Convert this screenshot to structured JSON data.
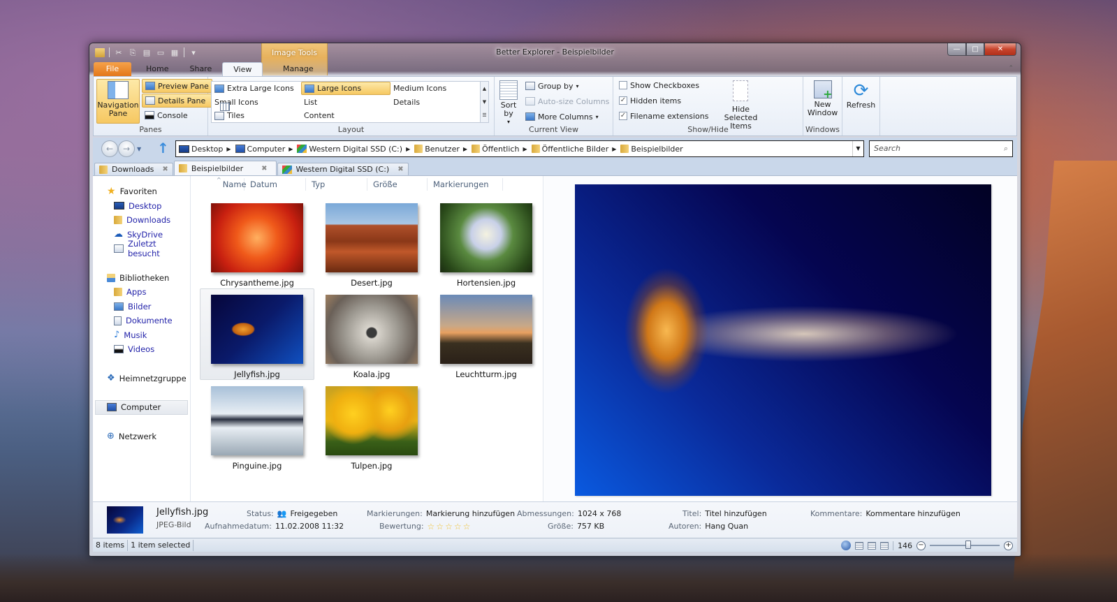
{
  "window": {
    "title": "Better Explorer - Beispielbilder",
    "controls": {
      "minimize": "—",
      "maximize": "□",
      "close": "✕"
    }
  },
  "ribbon": {
    "context_group": "Image Tools",
    "tabs": [
      "File",
      "Home",
      "Share",
      "View",
      "Manage"
    ],
    "active_tab": "View",
    "panes": {
      "label": "Panes",
      "navigation_pane": "Navigation Pane",
      "preview_pane": "Preview Pane",
      "details_pane": "Details Pane",
      "console": "Console"
    },
    "layout": {
      "label": "Layout",
      "items": [
        "Extra Large Icons",
        "Large Icons",
        "Medium Icons",
        "Small Icons",
        "List",
        "Details",
        "Tiles",
        "Content"
      ],
      "selected": "Large Icons"
    },
    "current_view": {
      "label": "Current View",
      "sort_by": "Sort by",
      "group_by": "Group by",
      "auto_size": "Auto-size Columns",
      "more_columns": "More Columns"
    },
    "show_hide": {
      "label": "Show/Hide",
      "show_checkboxes": {
        "label": "Show Checkboxes",
        "checked": false
      },
      "hidden_items": {
        "label": "Hidden items",
        "checked": true
      },
      "filename_extensions": {
        "label": "Filename extensions",
        "checked": true
      },
      "hide_selected": "Hide Selected Items"
    },
    "windows": {
      "label": "Windows",
      "new_window": "New Window"
    },
    "refresh": "Refresh"
  },
  "navigation": {
    "breadcrumb": [
      "Desktop",
      "Computer",
      "Western Digital SSD (C:)",
      "Benutzer",
      "Öffentlich",
      "Öffentliche Bilder",
      "Beispielbilder"
    ],
    "search_placeholder": "Search"
  },
  "folder_tabs": [
    {
      "label": "Downloads",
      "active": false
    },
    {
      "label": "Beispielbilder",
      "active": true
    },
    {
      "label": "Western Digital SSD (C:)",
      "active": false
    }
  ],
  "sidebar": {
    "favorites": {
      "label": "Favoriten",
      "items": [
        "Desktop",
        "Downloads",
        "SkyDrive",
        "Zuletzt besucht"
      ]
    },
    "libraries": {
      "label": "Bibliotheken",
      "items": [
        "Apps",
        "Bilder",
        "Dokumente",
        "Musik",
        "Videos"
      ]
    },
    "homegroup": "Heimnetzgruppe",
    "computer": "Computer",
    "network": "Netzwerk"
  },
  "file_list": {
    "columns": [
      "Name",
      "Datum",
      "Typ",
      "Größe",
      "Markierungen"
    ],
    "files": [
      {
        "name": "Chrysantheme.jpg",
        "selected": false
      },
      {
        "name": "Desert.jpg",
        "selected": false
      },
      {
        "name": "Hortensien.jpg",
        "selected": false
      },
      {
        "name": "Jellyfish.jpg",
        "selected": true
      },
      {
        "name": "Koala.jpg",
        "selected": false
      },
      {
        "name": "Leuchtturm.jpg",
        "selected": false
      },
      {
        "name": "Pinguine.jpg",
        "selected": false
      },
      {
        "name": "Tulpen.jpg",
        "selected": false
      }
    ]
  },
  "details": {
    "name": "Jellyfish.jpg",
    "type": "JPEG-Bild",
    "status_label": "Status:",
    "status_value": "Freigegeben",
    "date_label": "Aufnahmedatum:",
    "date_value": "11.02.2008 11:32",
    "tags_label": "Markierungen:",
    "tags_value": "Markierung hinzufügen",
    "rating_label": "Bewertung:",
    "rating_value": 0,
    "rating_max": 5,
    "dimensions_label": "Abmessungen:",
    "dimensions_value": "1024 x 768",
    "size_label": "Größe:",
    "size_value": "757 KB",
    "title_label": "Titel:",
    "title_value": "Titel hinzufügen",
    "authors_label": "Autoren:",
    "authors_value": "Hang Quan",
    "comments_label": "Kommentare:",
    "comments_value": "Kommentare hinzufügen"
  },
  "statusbar": {
    "item_count": "8 items",
    "selection": "1 item selected",
    "zoom": "146",
    "zoom_fraction": 0.55
  }
}
